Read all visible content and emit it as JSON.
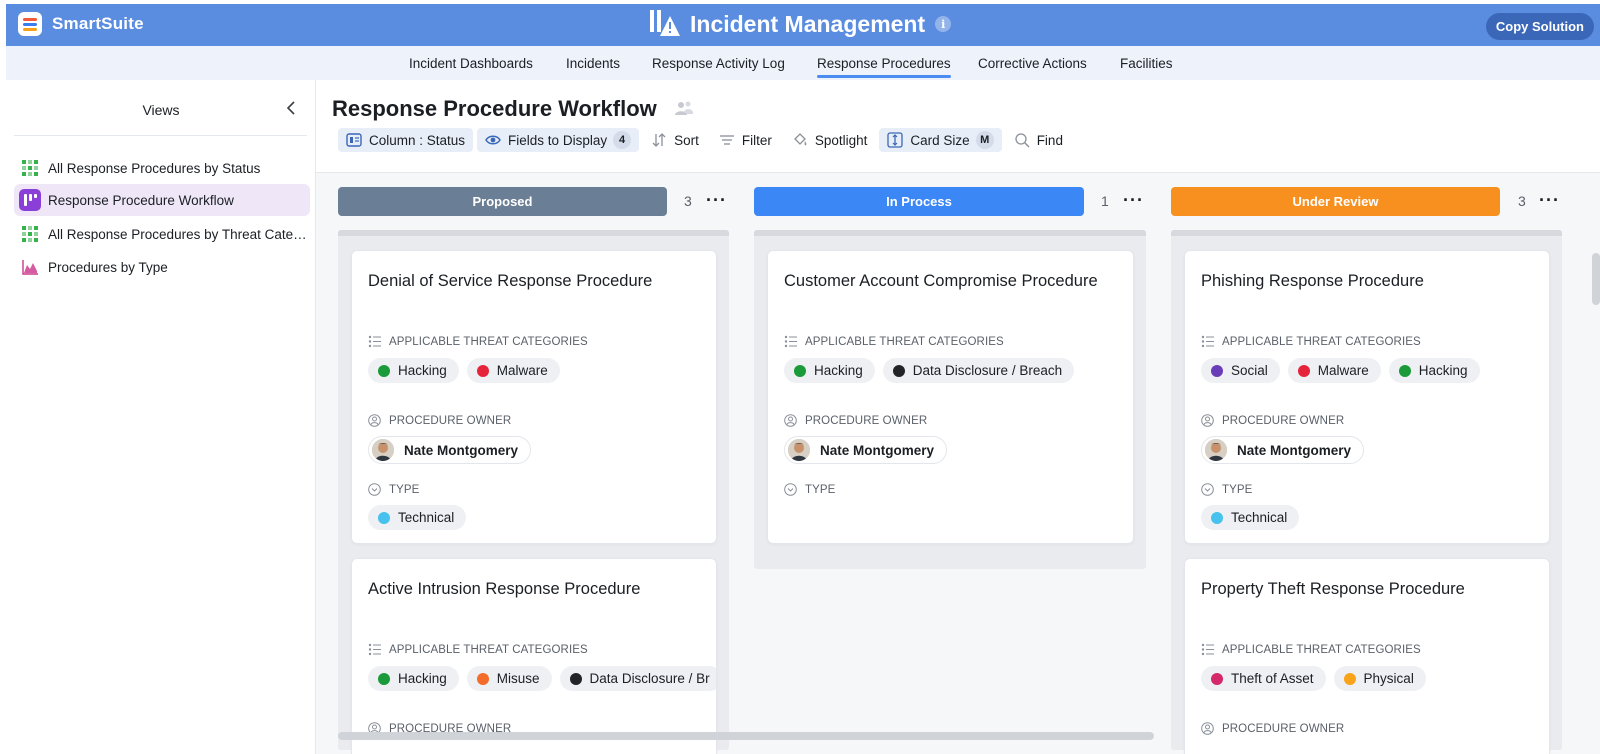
{
  "brand": {
    "name": "SmartSuite"
  },
  "app": {
    "title": "Incident Management",
    "info": "i",
    "copy_label": "Copy Solution"
  },
  "nav": {
    "tabs": [
      {
        "label": "Incident Dashboards"
      },
      {
        "label": "Incidents"
      },
      {
        "label": "Response Activity Log"
      },
      {
        "label": "Response Procedures"
      },
      {
        "label": "Corrective Actions"
      },
      {
        "label": "Facilities"
      }
    ]
  },
  "sidebar": {
    "title": "Views",
    "items": [
      {
        "label": "All Response Procedures by Status",
        "icon": "grid-icon"
      },
      {
        "label": "Response Procedure Workflow",
        "icon": "kanban-icon"
      },
      {
        "label": "All Response Procedures by Threat Categ...",
        "icon": "grid-icon"
      },
      {
        "label": "Procedures by Type",
        "icon": "chart-icon"
      }
    ]
  },
  "main": {
    "title": "Response Procedure Workflow",
    "toolbar": {
      "column": "Column : Status",
      "fields": "Fields to Display",
      "fields_count": "4",
      "sort": "Sort",
      "filter": "Filter",
      "spotlight": "Spotlight",
      "card_size": "Card Size",
      "card_size_value": "M",
      "find": "Find"
    }
  },
  "columns": [
    {
      "name": "Proposed",
      "count": "3",
      "color": "#6a7f95",
      "cards": [
        {
          "title": "Denial of Service Response Procedure",
          "categories_label": "APPLICABLE THREAT CATEGORIES",
          "categories": [
            {
              "label": "Hacking",
              "color": "#1a9a38"
            },
            {
              "label": "Malware",
              "color": "#e5233b"
            }
          ],
          "owner_label": "PROCEDURE OWNER",
          "owner": "Nate Montgomery",
          "type_label": "TYPE",
          "type": [
            {
              "label": "Technical",
              "color": "#47c1ee"
            }
          ]
        },
        {
          "title": "Active Intrusion Response Procedure",
          "categories_label": "APPLICABLE THREAT CATEGORIES",
          "categories": [
            {
              "label": "Hacking",
              "color": "#1a9a38"
            },
            {
              "label": "Misuse",
              "color": "#f36c2a"
            },
            {
              "label": "Data Disclosure / Br",
              "color": "#222428"
            }
          ],
          "owner_label": "PROCEDURE OWNER"
        }
      ]
    },
    {
      "name": "In Process",
      "count": "1",
      "color": "#3a87f5",
      "cards": [
        {
          "title": "Customer Account Compromise Procedure",
          "categories_label": "APPLICABLE THREAT CATEGORIES",
          "categories": [
            {
              "label": "Hacking",
              "color": "#1a9a38"
            },
            {
              "label": "Data Disclosure / Breach",
              "color": "#222428"
            }
          ],
          "owner_label": "PROCEDURE OWNER",
          "owner": "Nate Montgomery",
          "type_label": "TYPE"
        }
      ]
    },
    {
      "name": "Under Review",
      "count": "3",
      "color": "#f7901e",
      "cards": [
        {
          "title": "Phishing Response Procedure",
          "categories_label": "APPLICABLE THREAT CATEGORIES",
          "categories": [
            {
              "label": "Social",
              "color": "#6a3db8"
            },
            {
              "label": "Malware",
              "color": "#e5233b"
            },
            {
              "label": "Hacking",
              "color": "#1a9a38"
            }
          ],
          "owner_label": "PROCEDURE OWNER",
          "owner": "Nate Montgomery",
          "type_label": "TYPE",
          "type": [
            {
              "label": "Technical",
              "color": "#47c1ee"
            }
          ]
        },
        {
          "title": "Property Theft Response Procedure",
          "categories_label": "APPLICABLE THREAT CATEGORIES",
          "categories": [
            {
              "label": "Theft of Asset",
              "color": "#d4286a"
            },
            {
              "label": "Physical",
              "color": "#f9a31a"
            }
          ],
          "owner_label": "PROCEDURE OWNER"
        }
      ]
    }
  ]
}
